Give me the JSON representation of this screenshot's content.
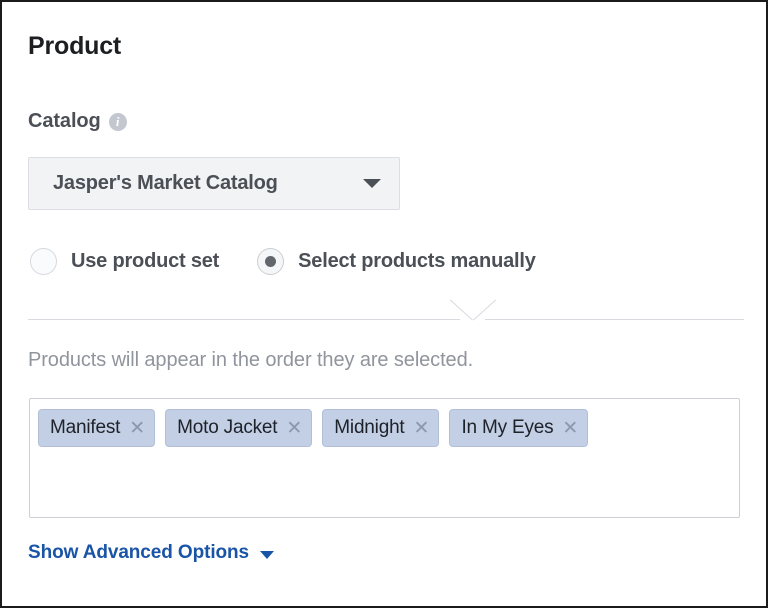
{
  "section": {
    "title": "Product"
  },
  "catalog": {
    "label": "Catalog",
    "info_icon": "info-icon",
    "selected": "Jasper's Market Catalog",
    "caret_icon": "chevron-down-icon"
  },
  "source_mode": {
    "options": [
      {
        "label": "Use product set",
        "selected": false
      },
      {
        "label": "Select products manually",
        "selected": true
      }
    ]
  },
  "products": {
    "helper_text": "Products will appear in the order they are selected.",
    "remove_icon": "close-icon",
    "tokens": [
      {
        "label": "Manifest"
      },
      {
        "label": "Moto Jacket"
      },
      {
        "label": "Midnight"
      },
      {
        "label": "In My Eyes"
      }
    ]
  },
  "advanced": {
    "label": "Show Advanced Options",
    "caret_icon": "chevron-down-icon"
  },
  "colors": {
    "accent_link": "#1a54a6",
    "token_fill": "#c3cfe4",
    "token_border": "#b1bfd8",
    "text_primary": "#1c1e21",
    "text_secondary": "#4b4f56",
    "text_muted": "#90949c",
    "field_fill": "#f2f3f5",
    "border": "#ccd0d5"
  }
}
